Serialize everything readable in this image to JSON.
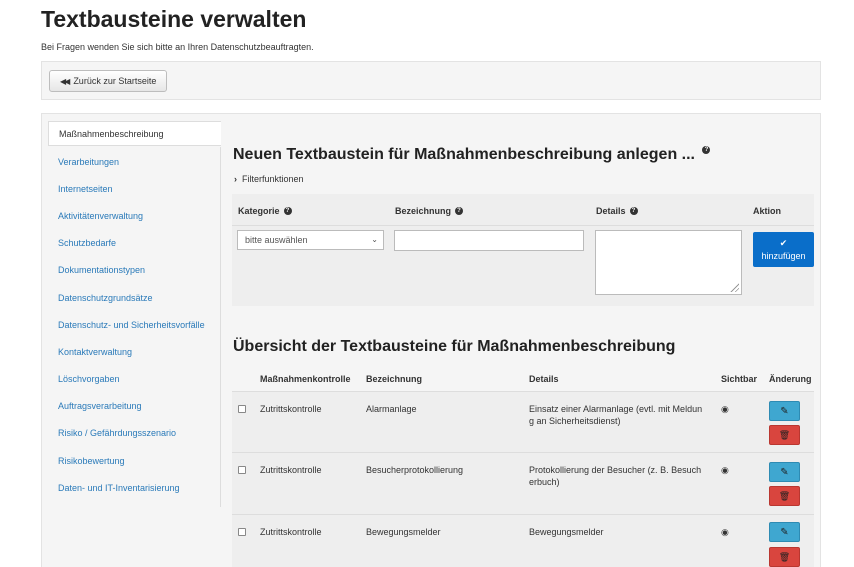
{
  "page": {
    "title": "Textbausteine verwalten",
    "subtitle": "Bei Fragen wenden Sie sich bitte an Ihren Datenschutzbeauftragten."
  },
  "toolbar": {
    "back_label": "Zurück zur Startseite"
  },
  "sidebar": {
    "items": [
      {
        "label": "Maßnahmenbeschreibung",
        "active": true
      },
      {
        "label": "Verarbeitungen"
      },
      {
        "label": "Internetseiten"
      },
      {
        "label": "Aktivitätenverwaltung"
      },
      {
        "label": "Schutzbedarfe"
      },
      {
        "label": "Dokumentationstypen"
      },
      {
        "label": "Datenschutzgrundsätze"
      },
      {
        "label": "Datenschutz- und Sicherheitsvorfälle"
      },
      {
        "label": "Kontaktverwaltung"
      },
      {
        "label": "Löschvorgaben"
      },
      {
        "label": "Auftragsverarbeitung"
      },
      {
        "label": "Risiko / Gefährdungsszenario"
      },
      {
        "label": "Risikobewertung"
      },
      {
        "label": "Daten- und IT-Inventarisierung"
      }
    ]
  },
  "form": {
    "title": "Neuen Textbaustein für Maßnahmenbeschreibung anlegen ...",
    "filter_label": "Filterfunktionen",
    "headers": {
      "kategorie": "Kategorie",
      "bezeichnung": "Bezeichnung",
      "details": "Details",
      "aktion": "Aktion"
    },
    "select_value": "bitte auswählen",
    "bezeichnung_value": "",
    "details_value": "",
    "add_label": "hinzufügen"
  },
  "overview": {
    "title": "Übersicht der Textbausteine für Maßnahmenbeschreibung",
    "columns": {
      "kontrolle": "Maßnahmenkontrolle",
      "bezeichnung": "Bezeichnung",
      "details": "Details",
      "sichtbar": "Sichtbar",
      "aenderung": "Änderung"
    },
    "rows": [
      {
        "kontrolle": "Zutrittskontrolle",
        "bezeichnung": "Alarmanlage",
        "details": [
          "Einsatz einer Alarmanlage (evtl. mit Meldun",
          "g an Sicherheitsdienst)"
        ]
      },
      {
        "kontrolle": "Zutrittskontrolle",
        "bezeichnung": "Besucherprotokollierung",
        "details": [
          "Protokollierung der Besucher (z. B. Besuch",
          "erbuch)"
        ]
      },
      {
        "kontrolle": "Zutrittskontrolle",
        "bezeichnung": "Bewegungsmelder",
        "details": [
          "Bewegungsmelder",
          ""
        ]
      }
    ]
  },
  "colors": {
    "link": "#2a7ab9",
    "primary": "#0a6ec9",
    "edit": "#3fa7d0",
    "delete": "#d9453e"
  },
  "icons": {
    "back": "backward-icon",
    "help": "question-circle-icon",
    "filter": "chevron-right-icon",
    "add": "check-icon",
    "visible": "eye-icon",
    "edit": "pencil-icon",
    "delete": "trash-icon"
  }
}
